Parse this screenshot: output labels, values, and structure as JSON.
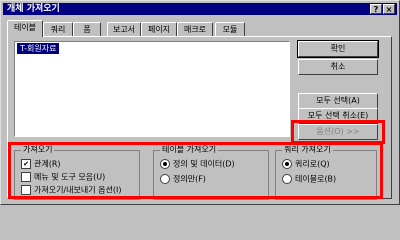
{
  "window": {
    "title": "개체 가져오기",
    "help_glyph": "?",
    "close_glyph": "×"
  },
  "tabs": [
    {
      "label": "테이블",
      "active": true
    },
    {
      "label": "쿼리"
    },
    {
      "label": "폼"
    },
    {
      "label": "보고서"
    },
    {
      "label": "페이지"
    },
    {
      "label": "매크로"
    },
    {
      "label": "모듈"
    }
  ],
  "list": {
    "items": [
      "T-회원자료"
    ]
  },
  "buttons": {
    "ok": "확인",
    "cancel": "취소",
    "select_all": "모두 선택(A)",
    "deselect_all": "모두 선택 취소(E)",
    "options": "옵션(O) >>"
  },
  "groups": {
    "import": {
      "label": "가져오기",
      "options": [
        {
          "label": "관계(R)",
          "checked": true
        },
        {
          "label": "메뉴 및 도구 모음(U)",
          "checked": false
        },
        {
          "label": "가져오기/내보내기 옵션(I)",
          "checked": false
        }
      ]
    },
    "import_tables": {
      "label": "테이블 가져오기",
      "options": [
        {
          "label": "정의 및 데이터(D)",
          "selected": true
        },
        {
          "label": "정의만(F)",
          "selected": false
        }
      ]
    },
    "import_queries": {
      "label": "쿼리 가져오기",
      "options": [
        {
          "label": "쿼리로(Q)",
          "selected": true
        },
        {
          "label": "테이블로(B)",
          "selected": false
        }
      ]
    }
  },
  "annotation_color": "#ff0000"
}
